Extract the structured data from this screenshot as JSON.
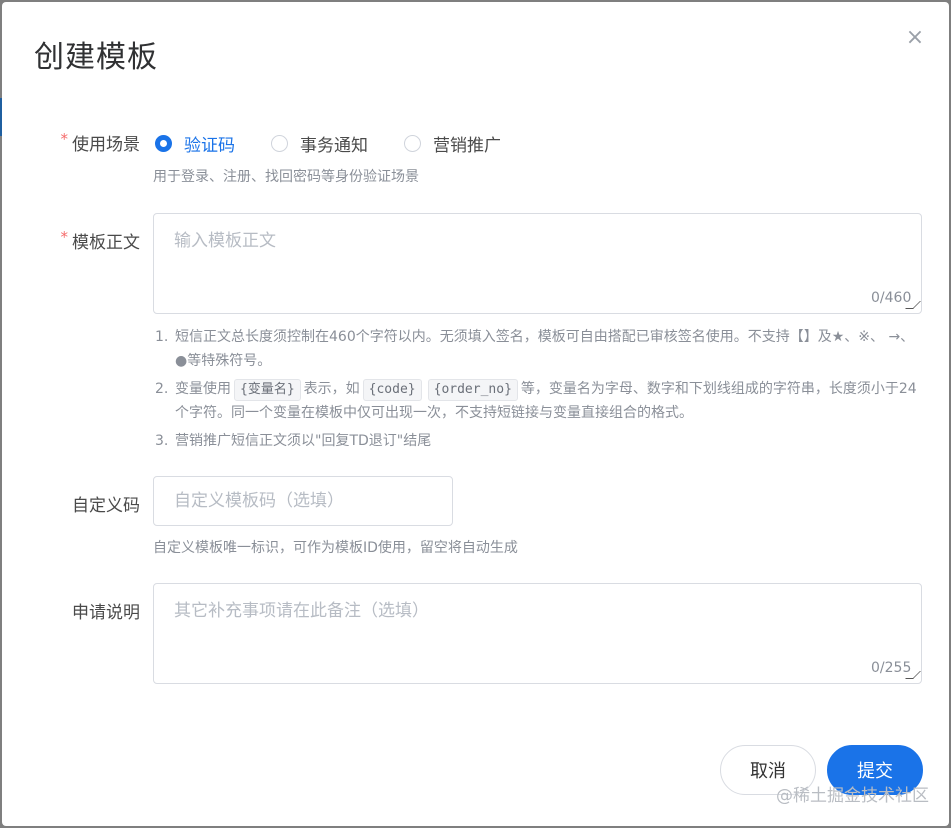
{
  "dialog": {
    "title": "创建模板",
    "close_glyph": "×"
  },
  "scene": {
    "label": "使用场景",
    "required_mark": "*",
    "options": [
      {
        "label": "验证码",
        "checked": true
      },
      {
        "label": "事务通知",
        "checked": false
      },
      {
        "label": "营销推广",
        "checked": false
      }
    ],
    "hint": "用于登录、注册、找回密码等身份验证场景"
  },
  "body": {
    "label": "模板正文",
    "required_mark": "*",
    "placeholder": "输入模板正文",
    "counter": "0/460",
    "notes": {
      "n1_num": "1.",
      "n1_text": "短信正文总长度须控制在460个字符以内。无须填入签名，模板可自由搭配已审核签名使用。不支持【】及★、※、 →、 ●等特殊符号。",
      "n2_num": "2.",
      "n2_pre": "变量使用",
      "n2_code1": "{变量名}",
      "n2_mid1": "表示，如",
      "n2_code2": "{code}",
      "n2_code3": "{order_no}",
      "n2_post": "等，变量名为字母、数字和下划线组成的字符串，长度须小于24个字符。同一个变量在模板中仅可出现一次，不支持短链接与变量直接组合的格式。",
      "n3_num": "3.",
      "n3_text": "营销推广短信正文须以\"回复TD退订\"结尾"
    }
  },
  "custom_code": {
    "label": "自定义码",
    "placeholder": "自定义模板码（选填）",
    "hint": "自定义模板唯一标识，可作为模板ID使用，留空将自动生成"
  },
  "description": {
    "label": "申请说明",
    "placeholder": "其它补充事项请在此备注（选填）",
    "counter": "0/255"
  },
  "footer": {
    "cancel_label": "取消",
    "submit_label": "提交"
  },
  "watermark": "@稀土掘金技术社区",
  "colors": {
    "primary": "#1a73e8",
    "required": "#f56c6c"
  }
}
